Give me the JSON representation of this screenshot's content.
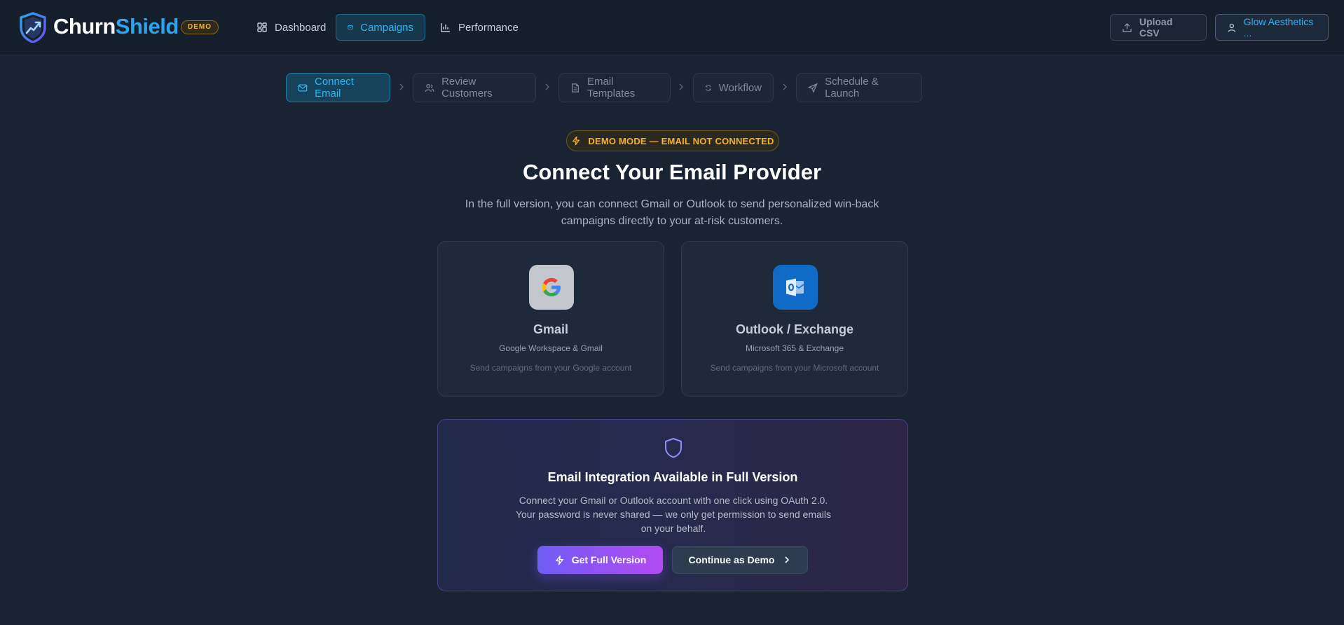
{
  "app": {
    "brand_part1": "Churn",
    "brand_part2": "Shield",
    "badge": "DEMO"
  },
  "nav": {
    "items": [
      {
        "label": "Dashboard",
        "icon": "grid-icon",
        "active": false
      },
      {
        "label": "Campaigns",
        "icon": "mail-icon",
        "active": true
      },
      {
        "label": "Performance",
        "icon": "bar-chart-icon",
        "active": false
      }
    ]
  },
  "header": {
    "upload_label": "Upload CSV",
    "account_label": "Glow Aesthetics ..."
  },
  "steps": [
    {
      "label": "Connect Email",
      "icon": "mail-icon",
      "active": true
    },
    {
      "label": "Review Customers",
      "icon": "users-icon",
      "active": false
    },
    {
      "label": "Email Templates",
      "icon": "document-icon",
      "active": false
    },
    {
      "label": "Workflow",
      "icon": "refresh-icon",
      "active": false
    },
    {
      "label": "Schedule & Launch",
      "icon": "send-icon",
      "active": false
    }
  ],
  "mode_banner": "DEMO MODE — EMAIL NOT CONNECTED",
  "page": {
    "title": "Connect Your Email Provider",
    "subtitle": "In the full version, you can connect Gmail or Outlook to send personalized win-back campaigns directly to your at-risk customers."
  },
  "providers": [
    {
      "name": "Gmail",
      "sub": "Google Workspace & Gmail",
      "desc": "Send campaigns from your Google account",
      "icon": "google-icon"
    },
    {
      "name": "Outlook / Exchange",
      "sub": "Microsoft 365 & Exchange",
      "desc": "Send campaigns from your Microsoft account",
      "icon": "outlook-icon"
    }
  ],
  "integration": {
    "title": "Email Integration Available in Full Version",
    "body": "Connect your Gmail or Outlook account with one click using OAuth 2.0. Your password is never shared — we only get permission to send emails on your behalf.",
    "primary_label": "Get Full Version",
    "secondary_label": "Continue as Demo"
  },
  "colors": {
    "background": "#1a2332",
    "accent": "#2eb6f5",
    "warning": "#f3b32a",
    "gradient_start": "#6f5cf5",
    "gradient_end": "#b34af2"
  }
}
